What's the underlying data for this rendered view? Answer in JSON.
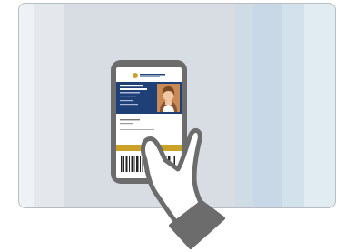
{
  "illustration": {
    "phone": {
      "id_card": {
        "header_name": "",
        "header_subtitle": ""
      }
    },
    "colors": {
      "frame_border": "#b9bdc3",
      "phone_body": "#6c6c6c",
      "card_header": "#1f3f77",
      "card_gold_bar": "#c9a227",
      "hand_outline": "#6c6c6c",
      "hand_cuff": "#6c6c6c"
    },
    "icons": [
      "phone-icon",
      "id-card-icon",
      "barcode-icon",
      "hand-icon"
    ]
  }
}
